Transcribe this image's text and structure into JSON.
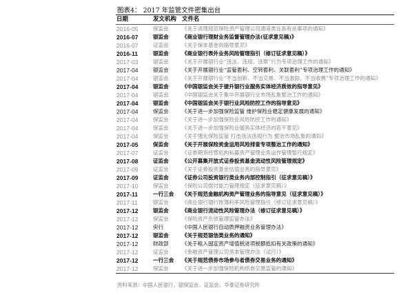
{
  "title": "图表4：    2017 年监管文件密集出台",
  "header": {
    "date": "日期",
    "agency": "发文机构",
    "name": "文件名"
  },
  "rows": [
    {
      "date": "2016-05",
      "agency": "保监会",
      "name": "《关于清理规范保险资产管理公司通道类业务有关事项的通知》",
      "style": "light"
    },
    {
      "date": "2016-07",
      "agency": "银监会",
      "name": "《商业银行理财业务监督管理办法(征求意见稿)》",
      "style": "bold"
    },
    {
      "date": "2016-07",
      "agency": "证监会",
      "name": "《关于保本基金的指导意见》",
      "style": "light"
    },
    {
      "date": "2016-11",
      "agency": "银监会",
      "name": "《商业银行表外业务风险管理指引（修订征求意见稿）》",
      "style": "bold"
    },
    {
      "date": "2017-03",
      "agency": "银监会",
      "name": "《关于开展银行业“违法、违规、违章”行为专项治理工作的通知》",
      "style": "light"
    },
    {
      "date": "2017-04",
      "agency": "银监会",
      "name": "《关于开展银行业“监管套利、空转套利、关联套利”专项治理工作的通知》",
      "style": "normal"
    },
    {
      "date": "2017-04",
      "agency": "银监会",
      "name": "《关于开展银行业“不当创新、不当交易、不当激励、不当收费”专项治理工作的通知》",
      "style": "light"
    },
    {
      "date": "2017-04",
      "agency": "银监会",
      "name": "《中国银监会关于提升银行业服务实体经济质效的指导意见》",
      "style": "bold"
    },
    {
      "date": "2017-04",
      "agency": "银监会",
      "name": "《中国银监会关于集中开展银行业市场乱象整治工作的通知》",
      "style": "light"
    },
    {
      "date": "2017-04",
      "agency": "银监会",
      "name": "《中国银监会关于银行业风险防控工作的指导意见》",
      "style": "bold"
    },
    {
      "date": "2017-04",
      "agency": "保监会",
      "name": "《关于进一步加强保险监管 维护保险业稳定健康发展的通知》",
      "style": "normal"
    },
    {
      "date": "2017-04",
      "agency": "保监会",
      "name": "《关于进一步加强保险业风险防控工作的通知》",
      "style": "light"
    },
    {
      "date": "2017-04",
      "agency": "保监会",
      "name": "《关于进一步加强保险业服务实体经济的若干意见》",
      "style": "light"
    },
    {
      "date": "2017-04",
      "agency": "保监会",
      "name": "《关于强化保险监管 打击违法违规行为 整治市场乱象的通知》",
      "style": "light"
    },
    {
      "date": "2017-05",
      "agency": "保监会",
      "name": "《关于开展保险资金运用风险排查专项整治工作的通知》",
      "style": "bold"
    },
    {
      "date": "2017-07",
      "agency": "证监会",
      "name": "《证券期货经营机构私募资产管理业务运作管理暂行规定》",
      "style": "light"
    },
    {
      "date": "2017-08",
      "agency": "证监会",
      "name": "《公开募集开放式证券投资基金流动性风险管理规定》",
      "style": "bold"
    },
    {
      "date": "2017-09",
      "agency": "证监会",
      "name": "《关于证券投资基金估值业务的指导意见》",
      "style": "light"
    },
    {
      "date": "2017-09",
      "agency": "证监会",
      "name": "《证券公司投资银行类业务内部控制指引（征求意见稿）》",
      "style": "bold"
    },
    {
      "date": "2017-10",
      "agency": "保监会",
      "name": "《保险公司偿付能力管理规定（征求意见稿）》",
      "style": "light"
    },
    {
      "date": "2017-11",
      "agency": "一行三会",
      "name": "《关于规范金融机构资产管理业务的指导意见（征求意见稿）》",
      "style": "bold"
    },
    {
      "date": "2017-11",
      "agency": "银监会",
      "name": "《商业银行银行账簿利率风险管理指引（修订征求意见稿）》",
      "style": "light"
    },
    {
      "date": "2017-12",
      "agency": "银监会",
      "name": "《商业银行流动性风险管理办法（修订征求意见稿）》",
      "style": "bold"
    },
    {
      "date": "2017-12",
      "agency": "保监会",
      "name": "《保险资产负债管理监管办法》",
      "style": "light"
    },
    {
      "date": "2017-12",
      "agency": "央行",
      "name": "《中国人民银行自动质押融资业务管理办法》",
      "style": "normal"
    },
    {
      "date": "2017-12",
      "agency": "银监会",
      "name": "《关于规范银信类业务的通知》",
      "style": "bold"
    },
    {
      "date": "2017-12",
      "agency": "财政部",
      "name": "《关于租入固定资产增值税进项税额抵扣有关政策的通知》",
      "style": "normal"
    },
    {
      "date": "2017-12",
      "agency": "证监会",
      "name": "《金融资产管理公司资本管理办法（试行）》",
      "style": "light"
    },
    {
      "date": "2017-12",
      "agency": "一行三会",
      "name": "《关于规范债券市场参与者债券交易业务的通知》",
      "style": "bold"
    },
    {
      "date": "2017-12",
      "agency": "保监会",
      "name": "《关于进一步加强保险机构债券交易监管的通知》",
      "style": "light"
    }
  ],
  "source": "资料来源：中国人民银行，银保监会，证监会，华泰证券研究所"
}
